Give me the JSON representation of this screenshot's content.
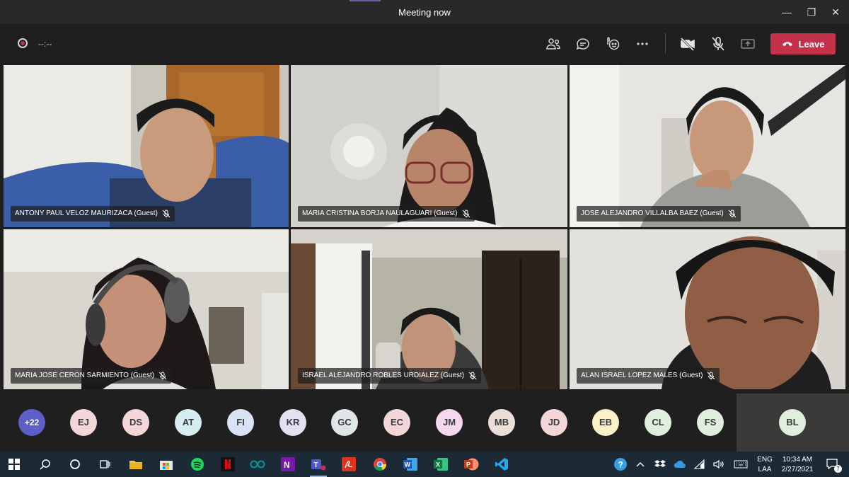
{
  "window": {
    "title": "Meeting now",
    "minimize_glyph": "—",
    "restore_glyph": "❐",
    "close_glyph": "✕"
  },
  "toolbar": {
    "timer": "--:--",
    "leave_label": "Leave",
    "icons": [
      "people-icon",
      "chat-icon",
      "reactions-icon",
      "more-options-icon",
      "camera-off-icon",
      "mic-off-icon",
      "share-tray-icon"
    ]
  },
  "participants_video": [
    {
      "name": "ANTONY PAUL VELOZ MAURIZACA (Guest)"
    },
    {
      "name": "MARIA CRISTINA BORJA NAULAGUARI (Guest)"
    },
    {
      "name": "JOSE ALEJANDRO VILLALBA BAEZ (Guest)"
    },
    {
      "name": "MARIA JOSE CERON SARMIENTO (Guest)"
    },
    {
      "name": "ISRAEL ALEJANDRO ROBLES URDIALEZ (Guest)"
    },
    {
      "name": "ALAN ISRAEL LOPEZ MALES (Guest)"
    }
  ],
  "participant_row": {
    "more_count": "+22",
    "avatars": [
      {
        "initials": "EJ",
        "color": "#f3d6d8"
      },
      {
        "initials": "DS",
        "color": "#f3d6d8"
      },
      {
        "initials": "AT",
        "color": "#d7eef0"
      },
      {
        "initials": "FI",
        "color": "#d9e3f6"
      },
      {
        "initials": "KR",
        "color": "#e3e0f1"
      },
      {
        "initials": "GC",
        "color": "#dfe6e8"
      },
      {
        "initials": "EC",
        "color": "#f3d6d8"
      },
      {
        "initials": "JM",
        "color": "#f7d7ee"
      },
      {
        "initials": "MB",
        "color": "#ecdfd8"
      },
      {
        "initials": "JD",
        "color": "#f3d6d8"
      },
      {
        "initials": "EB",
        "color": "#fbf1c7"
      },
      {
        "initials": "CL",
        "color": "#dfeedd"
      },
      {
        "initials": "FS",
        "color": "#dfeedd"
      },
      {
        "initials": "BL",
        "color": "#dfeedd"
      }
    ]
  },
  "taskbar": {
    "apps": [
      "windows-start-icon",
      "search-icon",
      "cortana-icon",
      "task-view-icon",
      "file-explorer-icon",
      "store-icon",
      "spotify-icon",
      "netflix-icon",
      "arduino-icon",
      "onenote-icon",
      "teams-icon",
      "acrobat-icon",
      "chrome-icon",
      "word-icon",
      "excel-icon",
      "powerpoint-icon",
      "vscode-icon"
    ],
    "lang_top": "ENG",
    "lang_bottom": "LAA",
    "time": "10:34 AM",
    "date": "2/27/2021",
    "notification_count": "7"
  },
  "colors": {
    "accent": "#6264a7",
    "leave_red": "#c4314b",
    "background": "#1f1f1f"
  }
}
